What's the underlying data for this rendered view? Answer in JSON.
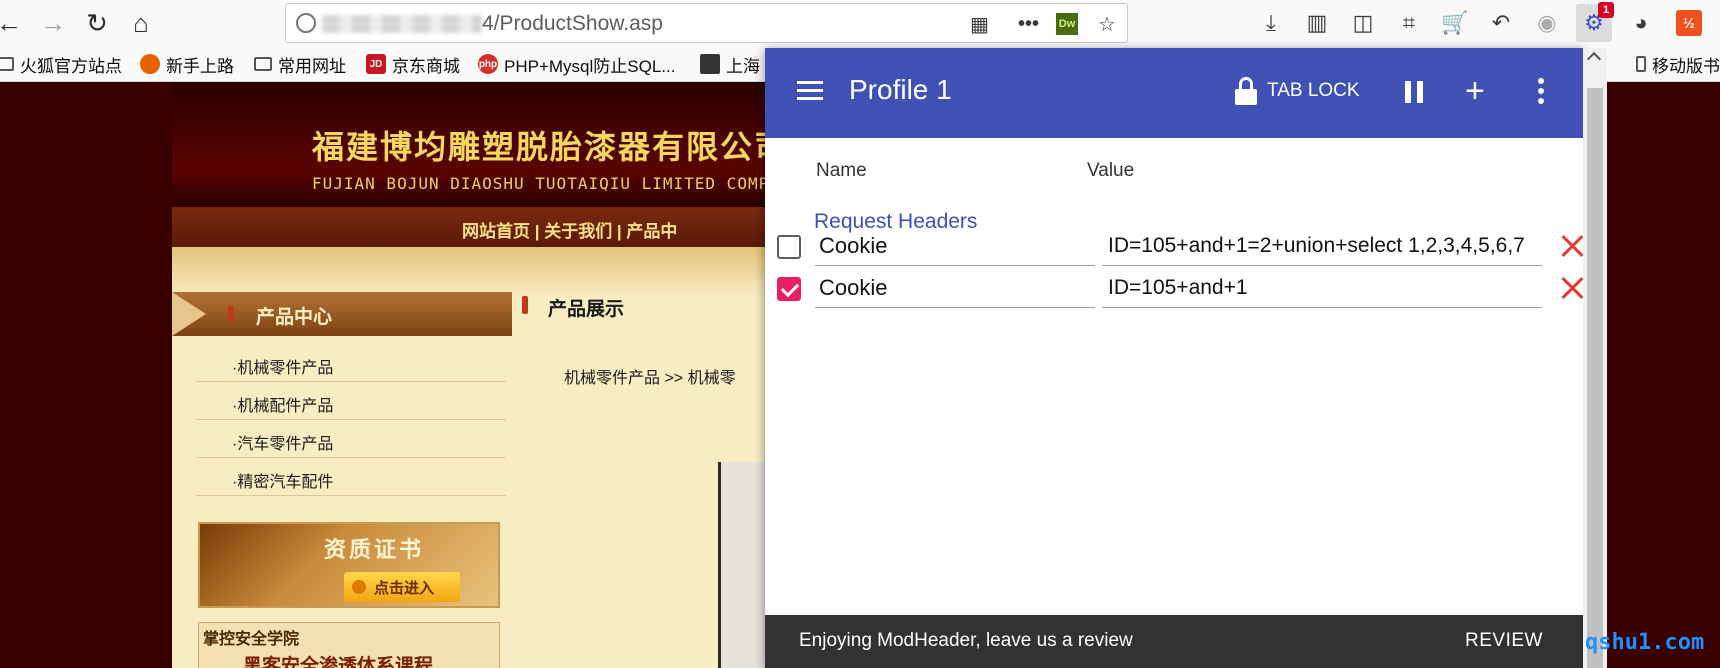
{
  "browser": {
    "url": "4/ProductShow.asp",
    "extension_badge": "1",
    "ext_dw_label": "Dw"
  },
  "bookmarks": [
    {
      "label": "火狐官方站点"
    },
    {
      "label": "新手上路"
    },
    {
      "label": "常用网址"
    },
    {
      "label": "京东商城",
      "icon_text": "JD"
    },
    {
      "label": "PHP+Mysql防止SQL...",
      "icon_text": "php"
    },
    {
      "label": "上海"
    },
    {
      "label": "移动版书"
    }
  ],
  "site": {
    "title": "福建博均雕塑脱胎漆器有限公司",
    "subtitle": "FUJIAN BOJUN DIAOSHU  TUOTAIQIU  LIMITED COMP",
    "nav": "网站首页   |   关于我们   |   产品中",
    "category_title": "产品中心",
    "categories": [
      "·机械零件产品",
      "·机械配件产品",
      "·汽车零件产品",
      "·精密汽车配件"
    ],
    "product_title": "产品展示",
    "breadcrumb": "机械零件产品 >> 机械零",
    "cert_title": "资质证书",
    "cert_button": "点击进入",
    "school_title": "掌控安全学院",
    "school_sub": "黑客安全渗透体系课程"
  },
  "modheader": {
    "profile_title": "Profile 1",
    "tab_lock_label": "TAB LOCK",
    "col_name": "Name",
    "col_value": "Value",
    "section_title": "Request Headers",
    "headers": [
      {
        "enabled": false,
        "name": "Cookie",
        "value": "ID=105+and+1=2+union+select 1,2,3,4,5,6,7"
      },
      {
        "enabled": true,
        "name": "Cookie",
        "value": "ID=105+and+1"
      }
    ],
    "snackbar_text": "Enjoying ModHeader, leave us a review",
    "snackbar_action": "REVIEW",
    "accent_color": "#3f51b5",
    "checkbox_color": "#e91e63",
    "delete_color": "#e53935"
  },
  "watermark": "qshu1.com"
}
